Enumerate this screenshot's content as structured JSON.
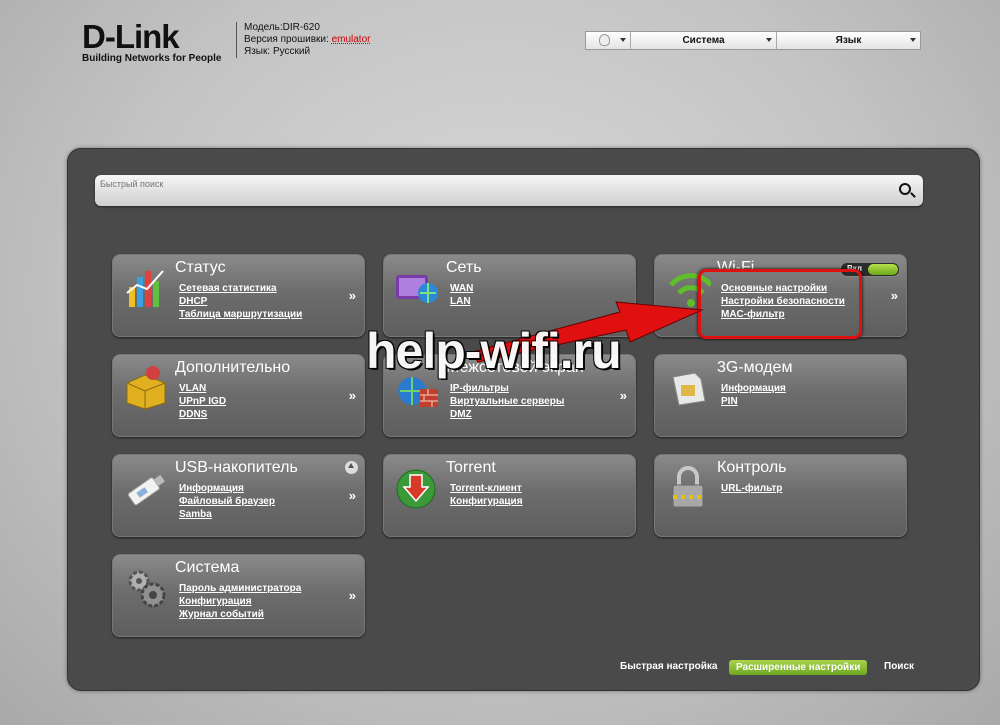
{
  "header": {
    "logo": "D-Link",
    "tagline": "Building Networks for People",
    "model_label": "Модель:",
    "model_value": "DIR-620",
    "firmware_label": "Версия прошивки:",
    "firmware_value": "emulator",
    "language_label": "Язык:",
    "language_value": "Русский"
  },
  "topbar": {
    "help_icon": "lightbulb-icon",
    "system_label": "Система",
    "language_label": "Язык"
  },
  "search": {
    "placeholder": "Быстрый поиск"
  },
  "cards": [
    {
      "title": "Статус",
      "icon": "bar-chart-icon",
      "links": [
        "Сетевая статистика",
        "DHCP",
        "Таблица маршрутизации"
      ]
    },
    {
      "title": "Сеть",
      "icon": "network-globe-icon",
      "links": [
        "WAN",
        "LAN"
      ]
    },
    {
      "title": "Wi-Fi",
      "icon": "wifi-icon",
      "toggle_label": "Вкл",
      "links": [
        "Основные настройки",
        "Настройки безопасности",
        "MAC-фильтр"
      ]
    },
    {
      "title": "Дополнительно",
      "icon": "box-gear-icon",
      "links": [
        "VLAN",
        "UPnP IGD",
        "DDNS"
      ]
    },
    {
      "title": "Межсетевой экран",
      "icon": "firewall-globe-icon",
      "links": [
        "IP-фильтры",
        "Виртуальные серверы",
        "DMZ"
      ]
    },
    {
      "title": "3G-модем",
      "icon": "sim-card-icon",
      "links": [
        "Информация",
        "PIN"
      ]
    },
    {
      "title": "USB-накопитель",
      "icon": "usb-drive-icon",
      "links": [
        "Информация",
        "Файловый браузер",
        "Samba"
      ]
    },
    {
      "title": "Torrent",
      "icon": "torrent-download-icon",
      "links": [
        "Torrent-клиент",
        "Конфигурация"
      ]
    },
    {
      "title": "Контроль",
      "icon": "padlock-icon",
      "links": [
        "URL-фильтр"
      ]
    },
    {
      "title": "Система",
      "icon": "gears-icon",
      "links": [
        "Пароль администратора",
        "Конфигурация",
        "Журнал событий"
      ]
    }
  ],
  "arrow_glyph": "»",
  "watermark": "help-wifi.ru",
  "footer": {
    "quick_setup": "Быстрая настройка",
    "advanced": "Расширенные настройки",
    "search": "Поиск"
  },
  "colors": {
    "accent_green": "#8cc63f",
    "highlight_red": "#e01010",
    "panel": "#4a4a4a"
  }
}
